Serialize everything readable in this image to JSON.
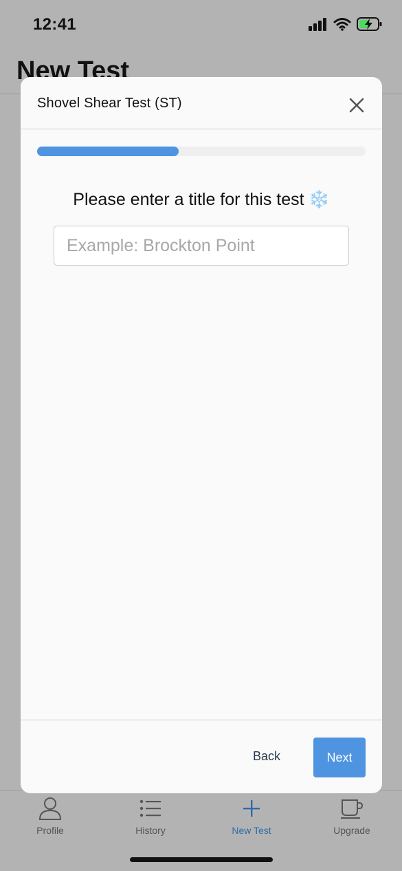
{
  "status_bar": {
    "time": "12:41",
    "icons": [
      "cellular-signal-icon",
      "wifi-icon",
      "battery-charging-icon"
    ]
  },
  "page": {
    "title": "New Test"
  },
  "modal": {
    "title": "Shovel Shear Test (ST)",
    "close_icon": "close-icon",
    "progress_fraction": 0.43,
    "prompt": "Please enter a title for this test",
    "prompt_emoji": "❄️",
    "title_input": {
      "value": "",
      "placeholder": "Example: Brockton Point"
    },
    "back_label": "Back",
    "next_label": "Next"
  },
  "tab_bar": {
    "items": [
      {
        "label": "Profile",
        "icon": "person-icon",
        "active": false
      },
      {
        "label": "History",
        "icon": "list-icon",
        "active": false
      },
      {
        "label": "New Test",
        "icon": "plus-icon",
        "active": true
      },
      {
        "label": "Upgrade",
        "icon": "coffee-cup-icon",
        "active": false
      }
    ]
  },
  "colors": {
    "accent": "#4f94e0",
    "active_tab": "#2f6aa8",
    "battery_charge": "#4cd964",
    "overlay_background": "#b3b3b3"
  }
}
